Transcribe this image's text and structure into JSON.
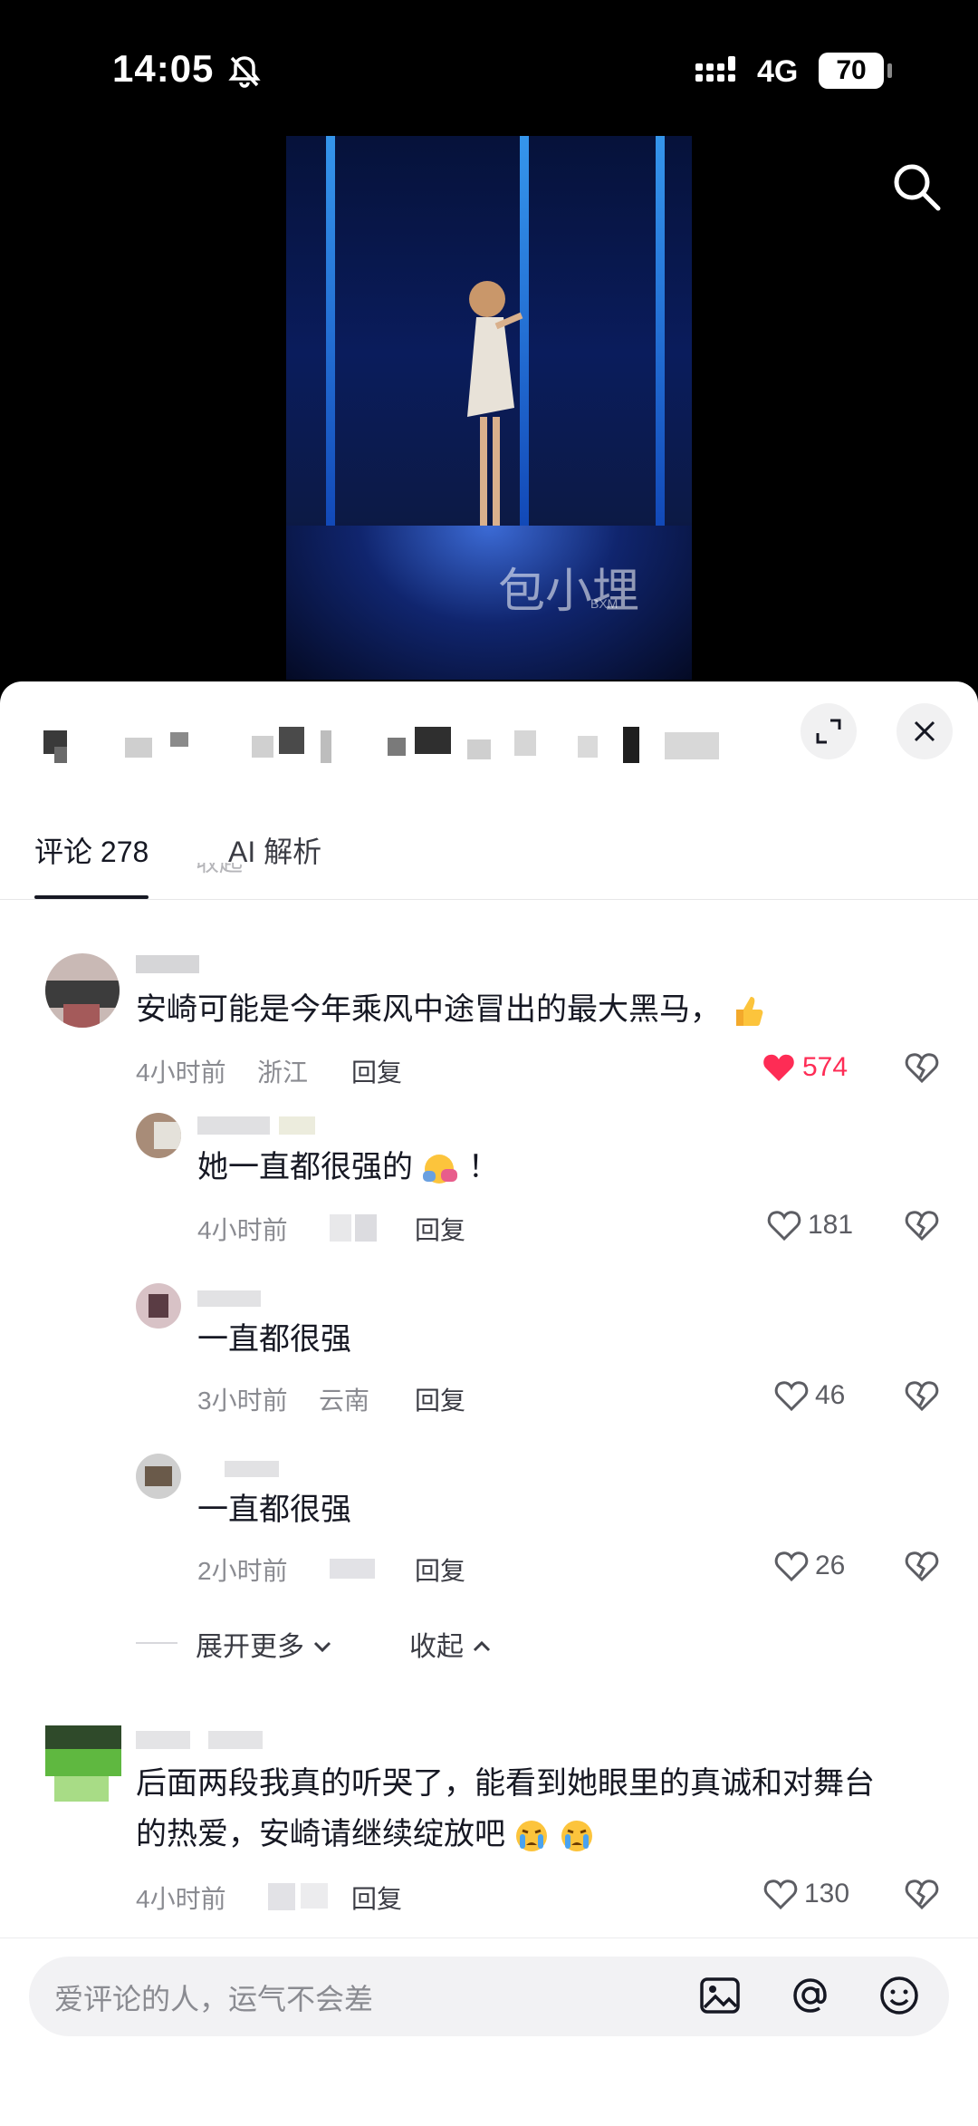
{
  "status": {
    "time": "14:05",
    "network": "4G",
    "battery": "70"
  },
  "tabs": {
    "comments": "评论 278",
    "ai": "AI 解析"
  },
  "cut_text": "收起",
  "comments": [
    {
      "text": "安崎可能是今年乘风中途冒出的最大黑马，",
      "time": "4小时前",
      "location": "浙江",
      "reply": "回复",
      "likes": "574",
      "liked": true
    },
    {
      "text": "她一直都很强的",
      "text_suffix": "！",
      "time": "4小时前",
      "location": "",
      "reply": "回复",
      "likes": "181"
    },
    {
      "text": "一直都很强",
      "time": "3小时前",
      "location": "云南",
      "reply": "回复",
      "likes": "46"
    },
    {
      "text": "一直都很强",
      "time": "2小时前",
      "location": "",
      "reply": "回复",
      "likes": "26"
    },
    {
      "text_line1": "后面两段我真的听哭了，能看到她眼里的真诚和对舞台",
      "text_line2": "的热爱，安崎请继续绽放吧",
      "time": "4小时前",
      "location": "",
      "reply": "回复",
      "likes": "130"
    }
  ],
  "expand_more": "展开更多",
  "collapse": "收起",
  "input_placeholder": "爱评论的人，运气不会差",
  "watermark": "包小埋",
  "watermark_sub": "BXM",
  "colors": {
    "like_red": "#fe2c55",
    "text": "#161823",
    "meta": "#8a8b91"
  }
}
